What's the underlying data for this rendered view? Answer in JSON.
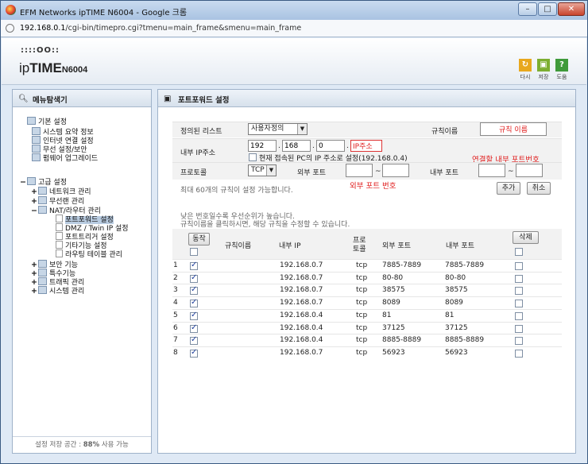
{
  "window": {
    "title": "EFM Networks ipTIME N6004 - Google 크롬",
    "min": "–",
    "max": "□",
    "close": "✕"
  },
  "address": {
    "host": "192.168.0.1",
    "path": "/cgi-bin/timepro.cgi?tmenu=main_frame&smenu=main_frame"
  },
  "header": {
    "logo_dots": "::::OO::",
    "logo_ip": "ip",
    "logo_time": "TIME",
    "logo_model": "N6004",
    "buttons": [
      {
        "icon": "refresh-icon",
        "glyph": "↻",
        "label": "다시"
      },
      {
        "icon": "save-icon",
        "glyph": "▣",
        "label": "저장"
      },
      {
        "icon": "help-icon",
        "glyph": "?",
        "label": "도움"
      }
    ]
  },
  "left_panel": {
    "title": "메뉴탐색기",
    "tree": [
      {
        "text": "기본 설정",
        "type": "folder",
        "toggle": "",
        "indent": 0
      },
      {
        "text": "시스템 요약 정보",
        "type": "leaf-icon",
        "indent": 1
      },
      {
        "text": "인터넷 연결 설정",
        "type": "leaf-icon",
        "indent": 1
      },
      {
        "text": "무선 설정/보안",
        "type": "leaf-icon",
        "indent": 1
      },
      {
        "text": "펌웨어 업그레이드",
        "type": "leaf-icon",
        "indent": 1
      },
      {
        "text": "고급 설정",
        "type": "folder",
        "toggle": "−",
        "indent": 0
      },
      {
        "text": "네트워크 관리",
        "type": "folder",
        "toggle": "+",
        "indent": 1
      },
      {
        "text": "무선랜 관리",
        "type": "folder",
        "toggle": "+",
        "indent": 1
      },
      {
        "text": "NAT/라우터 관리",
        "type": "folder",
        "toggle": "−",
        "indent": 1
      },
      {
        "text": "포트포워드 설정",
        "type": "doc",
        "indent": 2,
        "selected": true
      },
      {
        "text": "DMZ / Twin IP 설정",
        "type": "doc",
        "indent": 2
      },
      {
        "text": "포트트리거 설정",
        "type": "doc",
        "indent": 2
      },
      {
        "text": "기타기능 설정",
        "type": "doc",
        "indent": 2
      },
      {
        "text": "라우팅 테이블 관리",
        "type": "doc",
        "indent": 2
      },
      {
        "text": "보안 기능",
        "type": "folder",
        "toggle": "+",
        "indent": 1
      },
      {
        "text": "특수기능",
        "type": "folder",
        "toggle": "+",
        "indent": 1
      },
      {
        "text": "트래픽 관리",
        "type": "folder",
        "toggle": "+",
        "indent": 1
      },
      {
        "text": "시스템 관리",
        "type": "folder",
        "toggle": "+",
        "indent": 1
      }
    ],
    "footer_prefix": "설정 저장 공간 : ",
    "footer_value": "88%",
    "footer_suffix": " 사용 가능"
  },
  "main": {
    "title": "포트포워드 설정",
    "preset_label": "정의된 리스트",
    "preset_value": "사용자정의",
    "rule_name_label": "규칙이름",
    "rule_name_value": "규칙 이름",
    "internal_ip_label": "내부 IP주소",
    "ip1": "192",
    "ip2": "168",
    "ip3": "0",
    "ip4": "IP주소",
    "dot": ".",
    "current_pc_label": "현재 접속된 PC의 IP 주소로 설정(192.168.0.4)",
    "internal_port_hint": "연결할 내부 포트번호",
    "protocol_label": "프로토콜",
    "protocol_value": "TCP",
    "external_port_label": "외부 포트",
    "internal_port_label": "내부 포트",
    "tilde": "~",
    "max_rules_note": "최대 60개의 규칙이 설정 가능합니다.",
    "external_port_hint": "외부 포트 번호",
    "add_button": "추가",
    "cancel_button": "취소",
    "priority_note_1": "낮은 번호일수록 우선순위가 높습니다.",
    "priority_note_2": "규칙이름을 클릭하시면, 해당 규칙을 수정할 수 있습니다.",
    "run_button": "동작",
    "delete_button": "삭제",
    "columns": {
      "rule_name": "규칙이름",
      "internal_ip": "내부 IP",
      "protocol_1": "프로",
      "protocol_2": "토콜",
      "external_port": "외부 포트",
      "internal_port": "내부 포트"
    },
    "rows": [
      {
        "no": "1",
        "enabled": true,
        "name": "",
        "ip": "192.168.0.7",
        "proto": "tcp",
        "ext": "7885-7889",
        "int": "7885-7889"
      },
      {
        "no": "2",
        "enabled": true,
        "name": "",
        "ip": "192.168.0.7",
        "proto": "tcp",
        "ext": "80-80",
        "int": "80-80"
      },
      {
        "no": "3",
        "enabled": true,
        "name": "",
        "ip": "192.168.0.7",
        "proto": "tcp",
        "ext": "38575",
        "int": "38575"
      },
      {
        "no": "4",
        "enabled": true,
        "name": "",
        "ip": "192.168.0.7",
        "proto": "tcp",
        "ext": "8089",
        "int": "8089"
      },
      {
        "no": "5",
        "enabled": true,
        "name": "",
        "ip": "192.168.0.4",
        "proto": "tcp",
        "ext": "81",
        "int": "81"
      },
      {
        "no": "6",
        "enabled": true,
        "name": "",
        "ip": "192.168.0.4",
        "proto": "tcp",
        "ext": "37125",
        "int": "37125"
      },
      {
        "no": "7",
        "enabled": true,
        "name": "",
        "ip": "192.168.0.4",
        "proto": "tcp",
        "ext": "8885-8889",
        "int": "8885-8889"
      },
      {
        "no": "8",
        "enabled": true,
        "name": "",
        "ip": "192.168.0.7",
        "proto": "tcp",
        "ext": "56923",
        "int": "56923"
      }
    ]
  },
  "colors": {
    "accent_red": "#e01d1d",
    "panel_border": "#9fb2c9",
    "selected_bg": "#b8cbe0"
  }
}
